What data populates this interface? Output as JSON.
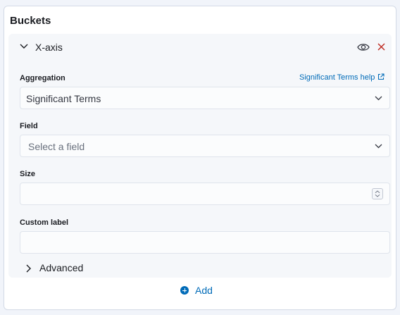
{
  "buckets": {
    "title": "Buckets",
    "aggregation_panel": {
      "title": "X-axis",
      "aggregation": {
        "label": "Aggregation",
        "help_link": "Significant Terms help",
        "selected": "Significant Terms"
      },
      "field": {
        "label": "Field",
        "placeholder": "Select a field"
      },
      "size": {
        "label": "Size",
        "value": ""
      },
      "custom_label": {
        "label": "Custom label",
        "value": ""
      },
      "advanced": {
        "label": "Advanced"
      }
    },
    "add_button": "Add"
  },
  "colors": {
    "accent": "#006bb8",
    "delete": "#bd271e"
  }
}
